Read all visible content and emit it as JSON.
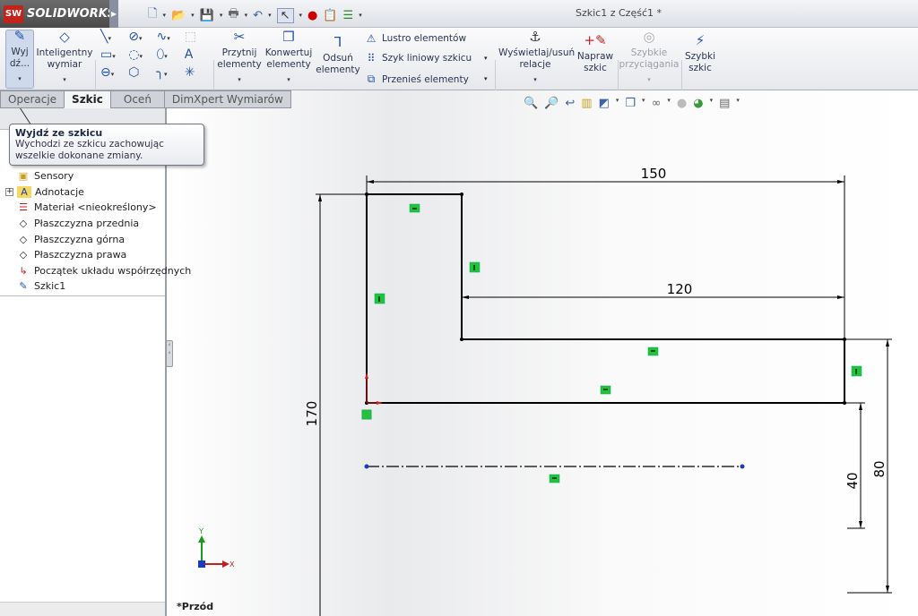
{
  "app": {
    "name": "SOLIDWORKS",
    "logo": "SW",
    "document_title": "Szkic1 z Część1 *"
  },
  "quick_access": [
    "new-icon",
    "open-icon",
    "save-icon",
    "print-icon",
    "undo-icon",
    "select-icon",
    "rebuild-icon",
    "file-properties-icon",
    "options-icon"
  ],
  "ribbon": {
    "exit_sketch": "Wyj dź...",
    "smart_dimension": "Inteligentny wymiar",
    "trim": "Przytnij elementy",
    "convert": "Konwertuj elementy",
    "offset": "Odsuń elementy",
    "mirror": "Lustro elementów",
    "linear_pattern": "Szyk liniowy szkicu",
    "move": "Przenieś elementy",
    "relations": "Wyświetlaj/usuń relacje",
    "repair": "Napraw szkic",
    "quick_snaps": "Szybkie przyciągania",
    "rapid_sketch": "Szybki szkic"
  },
  "tabs": [
    {
      "label": "Operacje",
      "active": false
    },
    {
      "label": "Szkic",
      "active": true
    },
    {
      "label": "Oceń",
      "active": false
    },
    {
      "label": "DimXpert Wymiarów",
      "active": false
    }
  ],
  "tooltip": {
    "title": "Wyjdź ze szkicu",
    "body": "Wychodzi ze szkicu zachowując wszelkie dokonane zmiany."
  },
  "tree": [
    {
      "label": "Sensory",
      "icon": "sensor-folder-icon"
    },
    {
      "label": "Adnotacje",
      "icon": "annotations-icon",
      "expandable": true
    },
    {
      "label": "Materiał <nieokreślony>",
      "icon": "material-icon"
    },
    {
      "label": "Płaszczyzna przednia",
      "icon": "plane-icon"
    },
    {
      "label": "Płaszczyzna górna",
      "icon": "plane-icon"
    },
    {
      "label": "Płaszczyzna prawa",
      "icon": "plane-icon"
    },
    {
      "label": "Początek układu współrzędnych",
      "icon": "origin-icon"
    },
    {
      "label": "Szkic1",
      "icon": "sketch-icon"
    }
  ],
  "sketch": {
    "dimensions": {
      "top_width": "150",
      "inner_width": "120",
      "height": "170",
      "right_height": "80",
      "offset": "40"
    },
    "line_color": "#000000",
    "relation_color": "#22c33a"
  },
  "triad": {
    "x": "X",
    "y": "Y"
  },
  "view_name": "*Przód"
}
